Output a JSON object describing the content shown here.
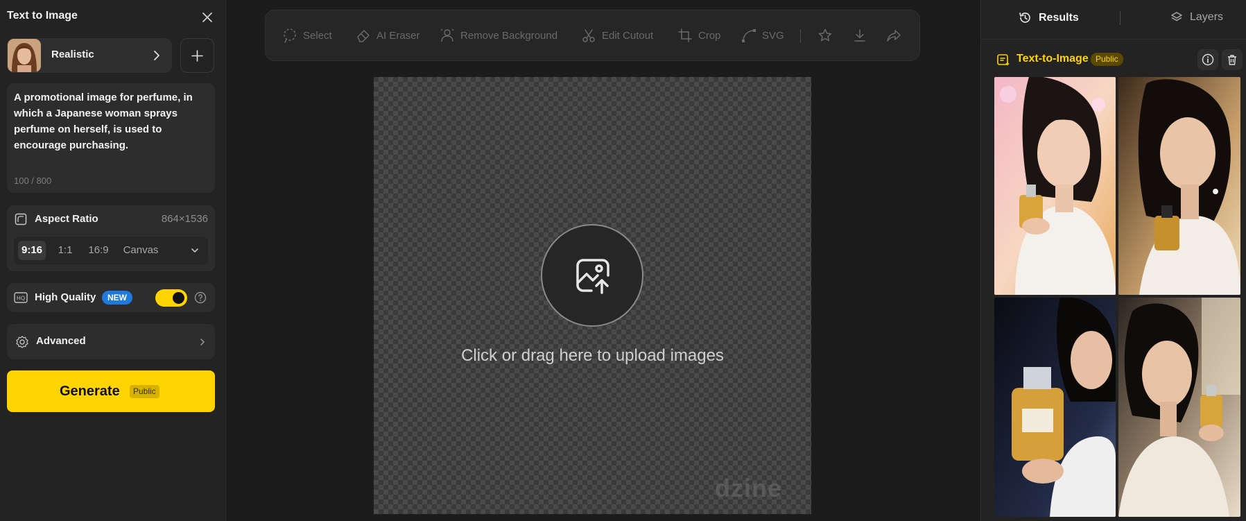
{
  "left_panel": {
    "title": "Text to Image",
    "style_name": "Realistic",
    "prompt": "A promotional image for perfume, in which a Japanese woman sprays perfume on herself, is used to encourage purchasing.",
    "prompt_count": "100 / 800",
    "aspect_ratio": {
      "label": "Aspect Ratio",
      "value": "864×1536",
      "options": [
        "9:16",
        "1:1",
        "16:9",
        "Canvas"
      ],
      "selected": "9:16"
    },
    "high_quality": {
      "label": "High Quality",
      "badge": "NEW",
      "enabled": true
    },
    "advanced_label": "Advanced",
    "generate": {
      "label": "Generate",
      "badge": "Public"
    }
  },
  "toolbar": {
    "tools": [
      "Select",
      "AI Eraser",
      "Remove Background",
      "Edit Cutout",
      "Crop",
      "SVG"
    ]
  },
  "canvas": {
    "upload_text": "Click or drag here to upload images",
    "watermark": "dzine"
  },
  "right_panel": {
    "tabs": [
      "Results",
      "Layers"
    ],
    "active_tab": "Results",
    "section_title": "Text-to-Image",
    "section_badge": "Public"
  },
  "colors": {
    "accent": "#ffd400",
    "new_badge": "#1f7ae0",
    "panel_bg": "#232323",
    "card_bg": "#2d2d2d"
  },
  "icons": {
    "close": "close-icon",
    "chevron": "chevron-right-icon",
    "add": "plus-icon",
    "aspect": "aspect-ratio-icon",
    "hq": "hd-icon",
    "help": "help-icon",
    "advanced": "gear-icon",
    "upload": "image-upload-icon",
    "results": "history-icon",
    "layers": "layers-icon",
    "info": "info-icon",
    "delete": "trash-icon"
  }
}
